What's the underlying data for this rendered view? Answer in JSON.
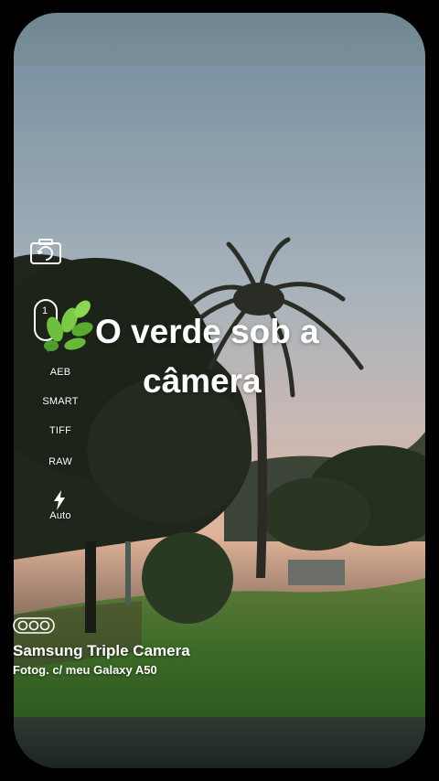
{
  "overlay": {
    "title_line1": "O verde sob a",
    "title_line2": "câmera"
  },
  "camera_sidebar": {
    "lens_number": "1",
    "options": [
      "AEB",
      "SMART",
      "TIFF",
      "RAW"
    ],
    "flash_mode": "Auto"
  },
  "watermark": {
    "device": "Samsung Triple Camera",
    "caption": "Fotog. c/ meu Galaxy A50"
  },
  "icons": {
    "camera": "camera-switch-icon",
    "lens": "lens-selector-icon",
    "leaf": "leaf-emoji-icon",
    "flash": "flash-icon",
    "triple_camera": "triple-camera-icon"
  },
  "colors": {
    "sky_top": "#7f98a8",
    "sky_horizon": "#d9b7a8",
    "grass": "#3f6a2a",
    "text": "#ffffff"
  }
}
